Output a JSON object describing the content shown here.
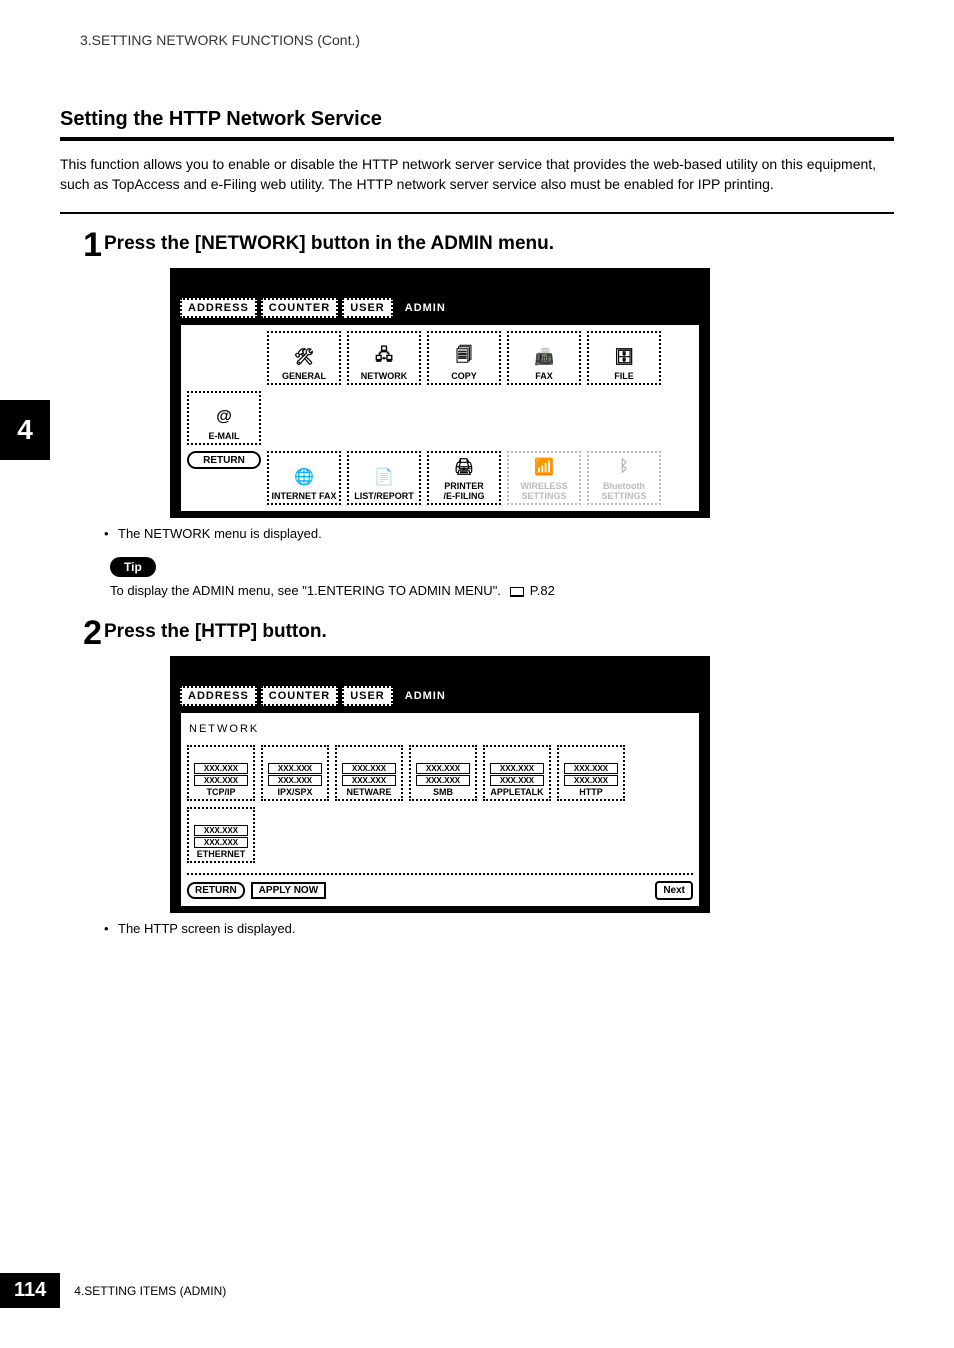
{
  "header_line": "3.SETTING NETWORK FUNCTIONS (Cont.)",
  "section_title": "Setting the HTTP Network Service",
  "intro": "This function allows you to enable or disable the HTTP network server service that provides the web-based utility on this equipment, such as TopAccess and e-Filing web utility. The HTTP network server service also must be enabled for IPP printing.",
  "chapter_tab": "4",
  "step1": {
    "num": "1",
    "title": "Press the [NETWORK] button in the ADMIN menu.",
    "tabs": {
      "address": "ADDRESS",
      "counter": "COUNTER",
      "user": "USER",
      "admin": "ADMIN"
    },
    "buttons": {
      "general": "GENERAL",
      "network": "NETWORK",
      "copy": "COPY",
      "fax": "FAX",
      "file": "FILE",
      "email": "E-MAIL",
      "internet_fax": "INTERNET FAX",
      "list_report": "LIST/REPORT",
      "printer_efiling": "PRINTER\n/E-FILING",
      "wireless": "WIRELESS\nSETTINGS",
      "bluetooth": "Bluetooth\nSETTINGS",
      "return": "RETURN"
    },
    "note": "The NETWORK menu is displayed."
  },
  "tip": {
    "badge": "Tip",
    "text_prefix": "To display the ADMIN menu, see \"1.ENTERING TO ADMIN MENU\".",
    "page_ref": "P.82"
  },
  "step2": {
    "num": "2",
    "title": "Press the [HTTP] button.",
    "tabs": {
      "address": "ADDRESS",
      "counter": "COUNTER",
      "user": "USER",
      "admin": "ADMIN"
    },
    "subheading": "NETWORK",
    "placeholder": "XXX.XXX",
    "cells": {
      "tcpip": "TCP/IP",
      "ipxspx": "IPX/SPX",
      "netware": "NETWARE",
      "smb": "SMB",
      "appletalk": "APPLETALK",
      "http": "HTTP",
      "ethernet": "ETHERNET"
    },
    "return": "RETURN",
    "apply_now": "APPLY NOW",
    "next": "Next",
    "note": "The HTTP screen is displayed."
  },
  "footer": {
    "page_num": "114",
    "chapter": "4.SETTING ITEMS (ADMIN)"
  }
}
